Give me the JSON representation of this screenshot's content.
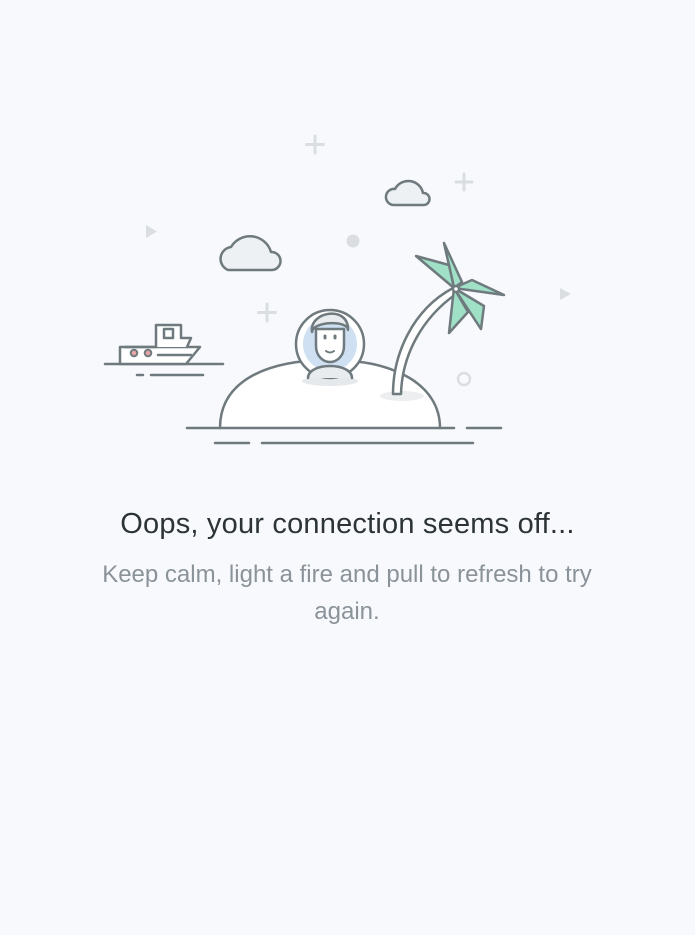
{
  "empty_state": {
    "title": "Oops, your connection seems off...",
    "message": "Keep calm, light a fire and pull to refresh to try again."
  },
  "colors": {
    "background": "#f8f9fc",
    "stroke": "#6f7a7e",
    "faint": "#d6dadd",
    "palm_leaf": "#9fe0c6",
    "avatar_bg": "#cfe0f3",
    "title": "#2d3436",
    "message": "#8a9399"
  },
  "icons": {
    "illustration": "desert-island-castaway",
    "boat": "boat-icon",
    "palm": "palm-tree-icon",
    "avatar": "castaway-avatar"
  }
}
